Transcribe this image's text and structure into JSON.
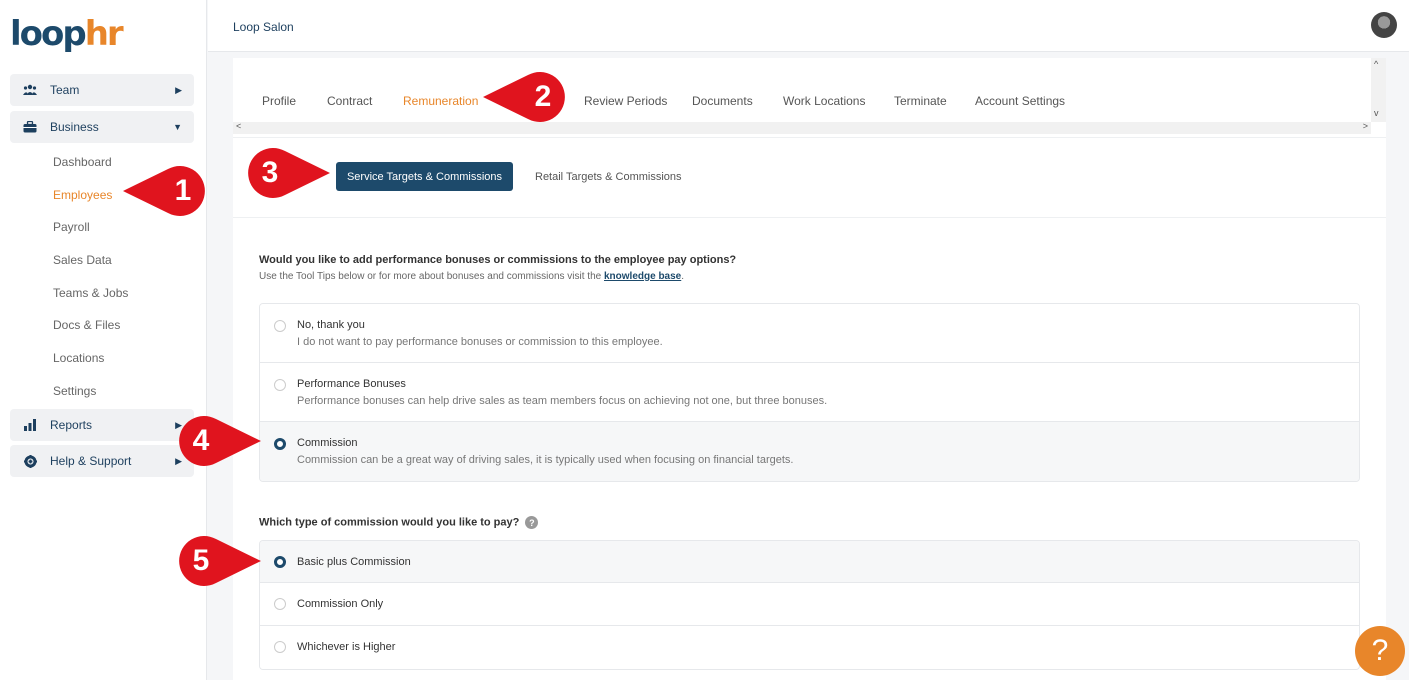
{
  "brand": {
    "logo_part1": "loop",
    "logo_part2": "hr"
  },
  "topbar": {
    "org_name": "Loop Salon"
  },
  "sidebar": {
    "groups": [
      {
        "label": "Team",
        "icon": "team-icon"
      },
      {
        "label": "Business",
        "icon": "briefcase-icon"
      },
      {
        "label": "Reports",
        "icon": "bar-chart-icon"
      },
      {
        "label": "Help & Support",
        "icon": "lifebuoy-icon"
      }
    ],
    "business_items": [
      "Dashboard",
      "Employees",
      "Payroll",
      "Sales Data",
      "Teams & Jobs",
      "Docs & Files",
      "Locations",
      "Settings"
    ],
    "active_item": "Employees"
  },
  "tabs": [
    "Profile",
    "Contract",
    "Remuneration",
    "Review Periods",
    "Documents",
    "Work Locations",
    "Terminate",
    "Account Settings"
  ],
  "active_tab": "Remuneration",
  "subtabs": {
    "active": "Service Targets & Commissions",
    "other": "Retail Targets & Commissions"
  },
  "bonus_question": {
    "title": "Would you like to add performance bonuses or commissions to the employee pay options?",
    "hint_prefix": "Use the Tool Tips below or for more about bonuses and commissions visit the ",
    "hint_link": "knowledge base",
    "hint_suffix": ".",
    "options": [
      {
        "title": "No, thank you",
        "desc": "I do not want to pay performance bonuses or commission to this employee.",
        "selected": false
      },
      {
        "title": "Performance Bonuses",
        "desc": "Performance bonuses can help drive sales as team members focus on achieving not one, but three bonuses.",
        "selected": false
      },
      {
        "title": "Commission",
        "desc": "Commission can be a great way of driving sales, it is typically used when focusing on financial targets.",
        "selected": true
      }
    ]
  },
  "commission_question": {
    "title": "Which type of commission would you like to pay?",
    "help": "?",
    "options": [
      {
        "title": "Basic plus Commission",
        "selected": true
      },
      {
        "title": "Commission Only",
        "selected": false
      },
      {
        "title": "Whichever is Higher",
        "selected": false
      }
    ]
  },
  "callouts": [
    "1",
    "2",
    "3",
    "4",
    "5"
  ],
  "help_fab": "?",
  "colors": {
    "brand_navy": "#1d4a6b",
    "accent_orange": "#e8862a",
    "callout_red": "#e0141e"
  }
}
